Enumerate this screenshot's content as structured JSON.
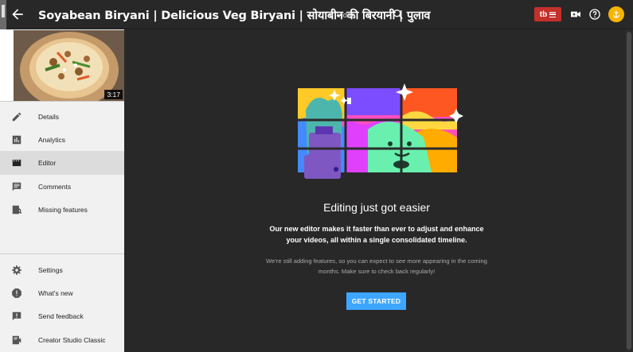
{
  "header": {
    "title": "Soyabean Biryani | Delicious Veg Biryani | सोयाबीन की बिरयानी | पुलाव",
    "type_tag": "Video",
    "avatar_letter": "⚓"
  },
  "studio_badge_text": "tb",
  "video": {
    "duration": "3:17"
  },
  "nav": {
    "items": [
      {
        "label": "Details",
        "icon": "pencil-icon"
      },
      {
        "label": "Analytics",
        "icon": "bar-chart-icon"
      },
      {
        "label": "Editor",
        "icon": "clapperboard-icon",
        "active": true
      },
      {
        "label": "Comments",
        "icon": "comment-icon"
      },
      {
        "label": "Missing features",
        "icon": "missing-features-icon"
      }
    ],
    "bottom_items": [
      {
        "label": "Settings",
        "icon": "gear-icon"
      },
      {
        "label": "What's new",
        "icon": "alert-icon"
      },
      {
        "label": "Send feedback",
        "icon": "feedback-icon"
      },
      {
        "label": "Creator Studio Classic",
        "icon": "classic-studio-icon"
      }
    ]
  },
  "main": {
    "heading": "Editing just got easier",
    "description": "Our new editor makes it faster than ever to adjust and enhance your videos, all within a single consolidated timeline.",
    "note": "We're still adding features, so you can expect to see more appearing in the coming months. Make sure to check back regularly!",
    "cta_label": "GET STARTED"
  },
  "colors": {
    "accent": "#3ea6ff",
    "brand_red": "#c4302b",
    "avatar": "#f5b400",
    "dark_bg": "#282828",
    "sidebar_bg": "#f1f1f1"
  }
}
